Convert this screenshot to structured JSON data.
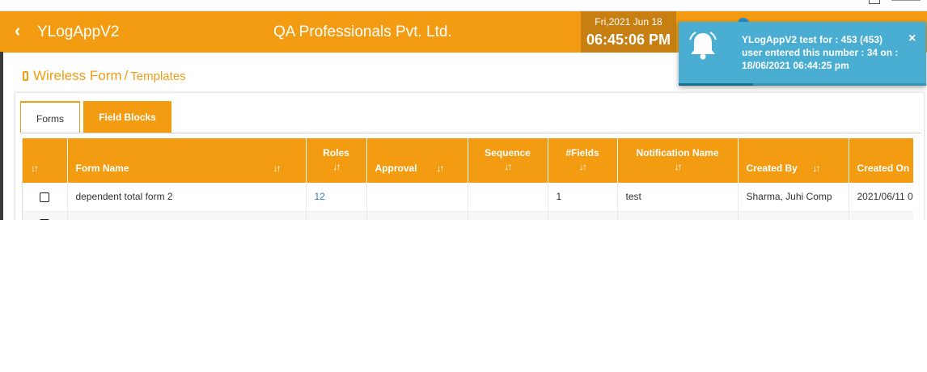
{
  "header": {
    "app_title": "YLogAppV2",
    "company": "QA Professionals Pvt. Ltd.",
    "date": "Fri,2021 Jun 18",
    "time": "06:45:06 PM"
  },
  "breadcrumb": {
    "main": "Wireless Form",
    "separator": "/",
    "sub": "Templates"
  },
  "tabs": [
    {
      "label": "Forms",
      "active": true
    },
    {
      "label": "Field Blocks",
      "active": false
    }
  ],
  "table": {
    "columns": {
      "form_name": "Form Name",
      "roles": "Roles",
      "approval": "Approval",
      "sequence": "Sequence",
      "fields": "#Fields",
      "notification": "Notification Name",
      "created_by": "Created By",
      "created_on": "Created On"
    },
    "rows": [
      {
        "form_name": "dependent total form 2",
        "roles": "12",
        "approval": "",
        "sequence": "",
        "fields": "1",
        "notification": "test",
        "created_by": "Sharma, Juhi Comp",
        "created_on": "2021/06/11 0"
      }
    ]
  },
  "toast": {
    "message": "YLogAppV2 test for : 453 (453) user entered this number : 34 on : 18/06/2021 06:44:25 pm",
    "close": "×",
    "progress": 0.3
  },
  "icons": {
    "back": "chevron-left-icon",
    "form": "mobile-phone-icon",
    "sort": "sort-icon",
    "bell": "bell-icon",
    "close": "close-icon"
  },
  "colors": {
    "accent": "#f39c12",
    "accent_dark": "#c77f12",
    "toast": "#4aaed3",
    "link": "#2f7fbf"
  }
}
